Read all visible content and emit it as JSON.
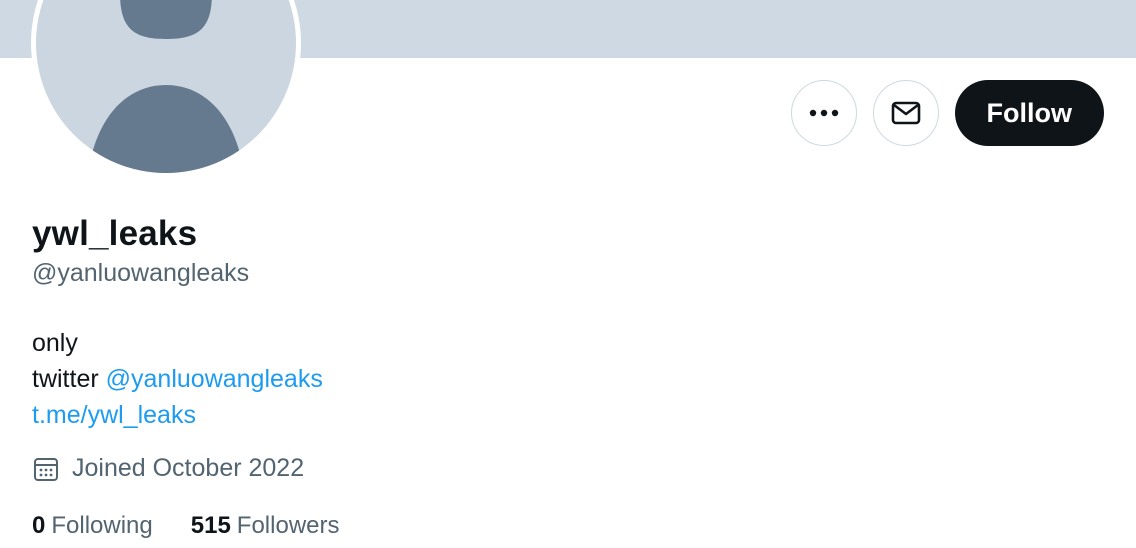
{
  "profile": {
    "display_name": "ywl_leaks",
    "handle": "@yanluowangleaks",
    "bio": {
      "line1": "only",
      "line2_prefix": "twitter",
      "line2_link": "@yanluowangleaks",
      "line3_link": "t.me/ywl_leaks"
    },
    "joined": "Joined October 2022",
    "following_count": "0",
    "following_label": "Following",
    "followers_count": "515",
    "followers_label": "Followers"
  },
  "actions": {
    "more_icon": "more-icon",
    "message_icon": "envelope-icon",
    "follow_label": "Follow"
  },
  "colors": {
    "banner": "#cfd9e3",
    "avatar_bg": "#ccd6e0",
    "avatar_figure": "#667a8f",
    "link": "#1d9bf0",
    "secondary_text": "#536471",
    "follow_button": "#0f1419"
  }
}
